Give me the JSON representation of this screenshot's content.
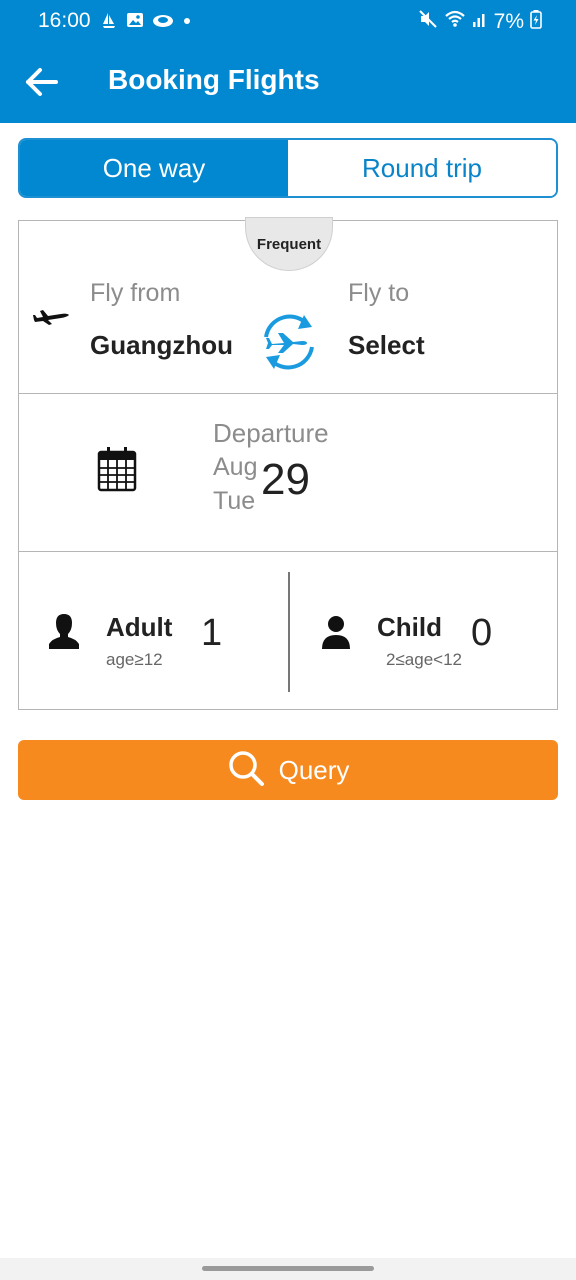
{
  "status_bar": {
    "time": "16:00",
    "battery": "7%",
    "left_icons": [
      "sailboat-icon",
      "image-icon",
      "cloud-icon",
      "dot-icon"
    ],
    "right_icons": [
      "mute-icon",
      "wifi-icon",
      "signal-icon",
      "battery-charging-icon"
    ]
  },
  "header": {
    "title": "Booking Flights",
    "back_icon": "back-arrow-icon"
  },
  "trip_type": {
    "options": [
      "One way",
      "Round trip"
    ],
    "selected": "One way"
  },
  "route": {
    "frequent_label": "Frequent",
    "from_label": "Fly from",
    "from_value": "Guangzhou",
    "to_label": "Fly to",
    "to_value": "Select"
  },
  "date": {
    "label": "Departure",
    "month": "Aug",
    "weekday": "Tue",
    "day": "29"
  },
  "passengers": {
    "adult": {
      "label": "Adult",
      "age_rule": "age≥12",
      "count": "1"
    },
    "child": {
      "label": "Child",
      "age_rule": "2≤age<12",
      "count": "0"
    }
  },
  "query_button": {
    "label": "Query"
  },
  "colors": {
    "primary": "#0288d1",
    "accent": "#f68a1f",
    "swap_icon": "#1a9be0"
  }
}
